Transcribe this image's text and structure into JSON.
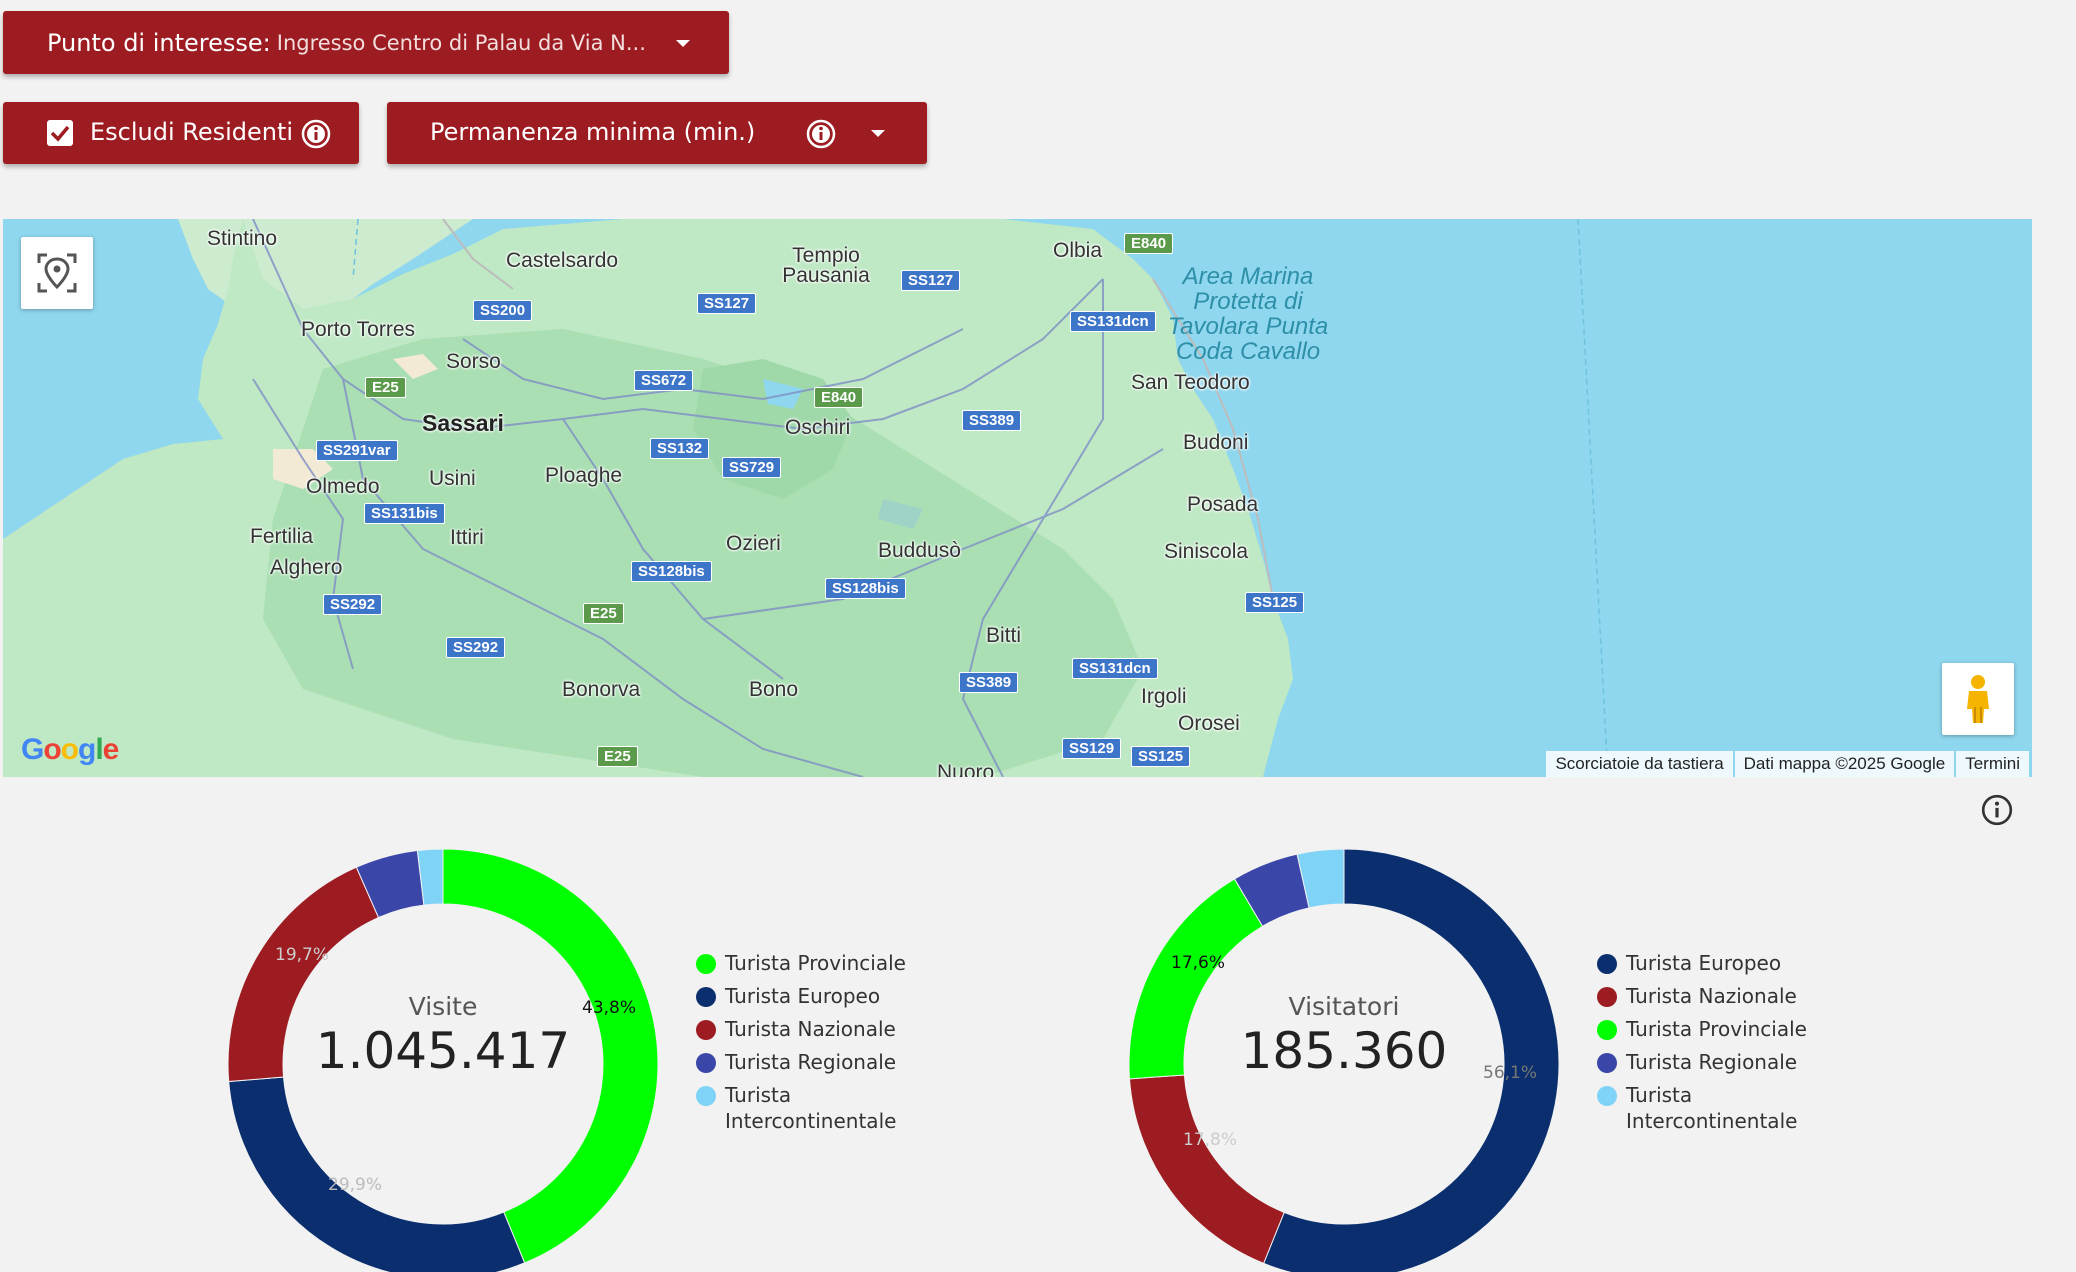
{
  "filters": {
    "poi_label": "Punto di interesse:",
    "poi_value": "Ingresso Centro di Palau da Via N...",
    "exclude_residents_label": "Escludi Residenti",
    "exclude_residents_checked": true,
    "min_stay_label": "Permanenza minima (min.)"
  },
  "map": {
    "cities": [
      "Stintino",
      "Castelsardo",
      "Tempio Pausania",
      "Olbia",
      "Porto Torres",
      "Sorso",
      "Sassari",
      "Oschiri",
      "San Teodoro",
      "Budoni",
      "Olmedo",
      "Usini",
      "Ploaghe",
      "Posada",
      "Fertilia",
      "Ittiri",
      "Alghero",
      "Ozieri",
      "Buddusò",
      "Siniscola",
      "Bitti",
      "Irgoli",
      "Bonorva",
      "Bono",
      "Orosei",
      "Nuoro"
    ],
    "sea_label": "Area Marina Protetta di Tavolara Punta Coda Cavallo",
    "roads": [
      "SS200",
      "SS127",
      "SS127",
      "E840",
      "SS131dcn",
      "E25",
      "SS672",
      "E840",
      "SS389",
      "SS291var",
      "SS132",
      "SS729",
      "SS131bis",
      "SS128bis",
      "SS128bis",
      "SS292",
      "E25",
      "SS292",
      "SS125",
      "SS389",
      "SS131dcn",
      "SS129",
      "SS125",
      "E25"
    ],
    "attribution": [
      "Scorciatoie da tastiera",
      "Dati mappa ©2025 Google",
      "Termini"
    ],
    "logo": "Google"
  },
  "visite": {
    "label": "Visite",
    "total": "1.045.417",
    "legend": [
      {
        "name": "Turista Provinciale",
        "color": "#00ff00"
      },
      {
        "name": "Turista Europeo",
        "color": "#0b2f6e"
      },
      {
        "name": "Turista Nazionale",
        "color": "#9c1c22"
      },
      {
        "name": "Turista Regionale",
        "color": "#3a46a8"
      },
      {
        "name": "Turista Intercontinentale",
        "color": "#7fd3f7"
      }
    ],
    "pct_labels": [
      "43,8%",
      "29,9%",
      "19,7%"
    ]
  },
  "visitatori": {
    "label": "Visitatori",
    "total": "185.360",
    "legend": [
      {
        "name": "Turista Europeo",
        "color": "#0b2f6e"
      },
      {
        "name": "Turista Nazionale",
        "color": "#9c1c22"
      },
      {
        "name": "Turista Provinciale",
        "color": "#00ff00"
      },
      {
        "name": "Turista Regionale",
        "color": "#3a46a8"
      },
      {
        "name": "Turista Intercontinentale",
        "color": "#7fd3f7"
      }
    ],
    "pct_labels": [
      "56,1%",
      "17,8%",
      "17,6%"
    ]
  },
  "chart_data": [
    {
      "type": "pie",
      "title": "Visite",
      "categories": [
        "Turista Provinciale",
        "Turista Europeo",
        "Turista Nazionale",
        "Turista Regionale",
        "Turista Intercontinentale"
      ],
      "values": [
        43.8,
        29.9,
        19.7,
        4.7,
        1.9
      ]
    },
    {
      "type": "pie",
      "title": "Visitatori",
      "categories": [
        "Turista Europeo",
        "Turista Nazionale",
        "Turista Provinciale",
        "Turista Regionale",
        "Turista Intercontinentale"
      ],
      "values": [
        56.1,
        17.8,
        17.6,
        5.0,
        3.5
      ]
    }
  ]
}
